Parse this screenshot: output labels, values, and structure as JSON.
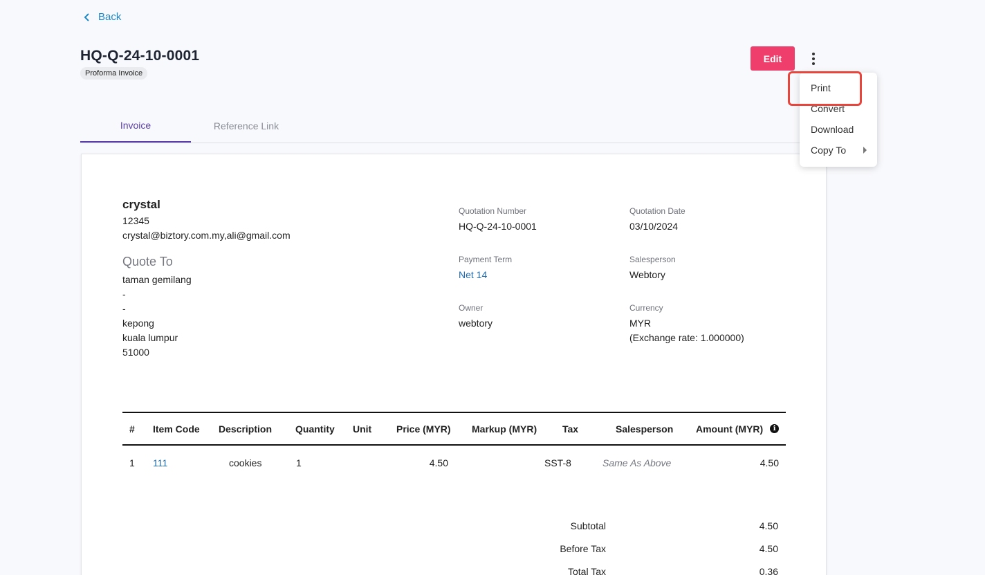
{
  "nav": {
    "back_label": "Back"
  },
  "header": {
    "title": "HQ-Q-24-10-0001",
    "badge": "Proforma Invoice",
    "edit_label": "Edit"
  },
  "tabs": [
    {
      "label": "Invoice",
      "active": true
    },
    {
      "label": "Reference Link",
      "active": false
    }
  ],
  "sender": {
    "name": "crystal",
    "phone": "12345",
    "email": "crystal@biztory.com.my,ali@gmail.com"
  },
  "quote_to": {
    "heading": "Quote To",
    "lines": [
      "taman gemilang",
      "-",
      "-",
      "kepong",
      "kuala lumpur",
      "51000"
    ]
  },
  "meta": {
    "quotation_number_label": "Quotation Number",
    "quotation_number": "HQ-Q-24-10-0001",
    "quotation_date_label": "Quotation Date",
    "quotation_date": "03/10/2024",
    "payment_term_label": "Payment Term",
    "payment_term": "Net 14",
    "salesperson_label": "Salesperson",
    "salesperson": "Webtory",
    "owner_label": "Owner",
    "owner": "webtory",
    "currency_label": "Currency",
    "currency": "MYR",
    "exchange_rate": "(Exchange rate: 1.000000)"
  },
  "table": {
    "headers": {
      "num": "#",
      "item_code": "Item Code",
      "description": "Description",
      "quantity": "Quantity",
      "unit": "Unit",
      "price": "Price (MYR)",
      "markup": "Markup (MYR)",
      "tax": "Tax",
      "salesperson": "Salesperson",
      "amount": "Amount (MYR)"
    },
    "rows": [
      {
        "num": "1",
        "item_code": "111",
        "description": "cookies",
        "quantity": "1",
        "unit": "",
        "price": "4.50",
        "markup": "",
        "tax": "SST-8",
        "salesperson": "Same As Above",
        "amount": "4.50"
      }
    ]
  },
  "summary": {
    "subtotal_label": "Subtotal",
    "subtotal": "4.50",
    "before_tax_label": "Before Tax",
    "before_tax": "4.50",
    "total_tax_label": "Total Tax",
    "total_tax": "0.36"
  },
  "menu": {
    "items": [
      "Print",
      "Convert",
      "Download",
      "Copy To"
    ]
  },
  "colors": {
    "accent": "#ef3e6b",
    "tab_active": "#5b3fa8",
    "link": "#1e6aab",
    "highlight": "#e8453c"
  }
}
